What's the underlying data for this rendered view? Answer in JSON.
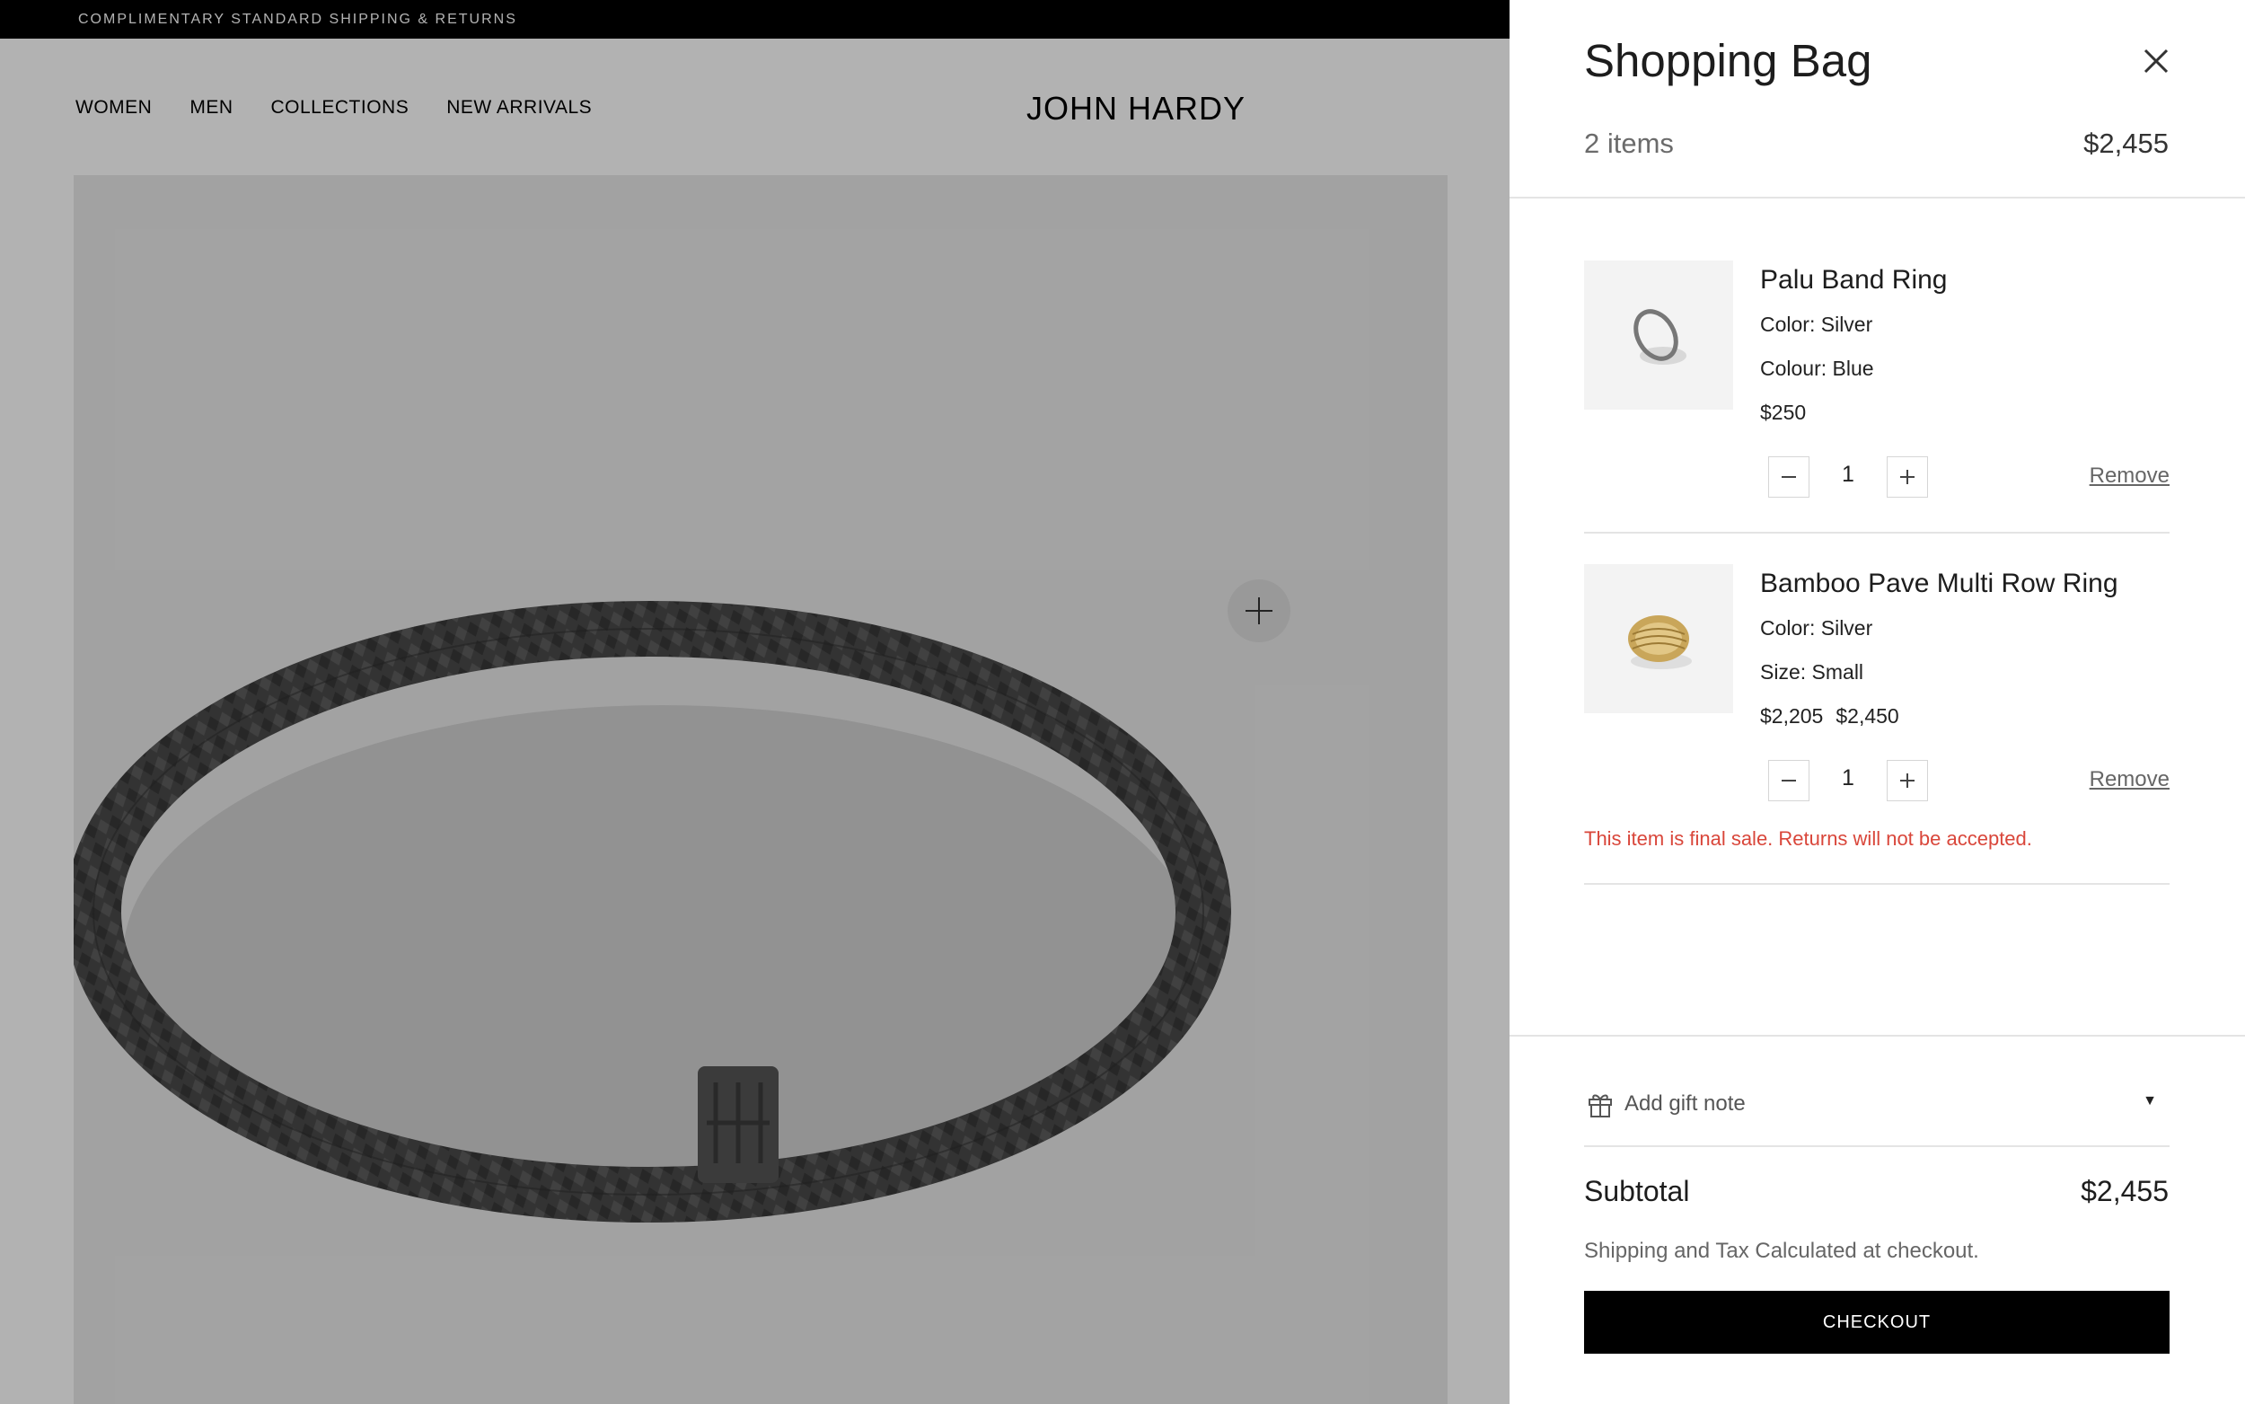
{
  "announcement": {
    "text": "COMPLIMENTARY STANDARD SHIPPING & RETURNS"
  },
  "nav": {
    "links": [
      "WOMEN",
      "MEN",
      "COLLECTIONS",
      "NEW ARRIVALS"
    ],
    "logo": "JOHN HARDY"
  },
  "product_view": {
    "zoom_icon": "plus-icon"
  },
  "bag": {
    "title": "Shopping Bag",
    "item_count": "2 items",
    "total": "$2,455",
    "close_icon": "close-icon",
    "items": [
      {
        "name": "Palu Band Ring",
        "attr1": "Color: Silver",
        "attr2": "Colour: Blue",
        "price": "$250",
        "compare_price": "",
        "quantity": "1",
        "remove_label": "Remove",
        "notice": ""
      },
      {
        "name": "Bamboo Pave Multi Row Ring",
        "attr1": "Color: Silver",
        "attr2": "Size: Small",
        "price": "$2,205",
        "compare_price": "$2,450",
        "quantity": "1",
        "remove_label": "Remove",
        "notice": "This item is final sale. Returns will not be accepted."
      }
    ],
    "gift_note": {
      "label": "Add gift note",
      "icon": "gift-icon"
    },
    "subtotal_label": "Subtotal",
    "subtotal_value": "$2,455",
    "shipping_note": "Shipping and Tax Calculated at checkout.",
    "checkout_label": "CHECKOUT"
  },
  "colors": {
    "overlay": "#000000",
    "notice": "#d9463a",
    "checkout_bg": "#000000"
  }
}
